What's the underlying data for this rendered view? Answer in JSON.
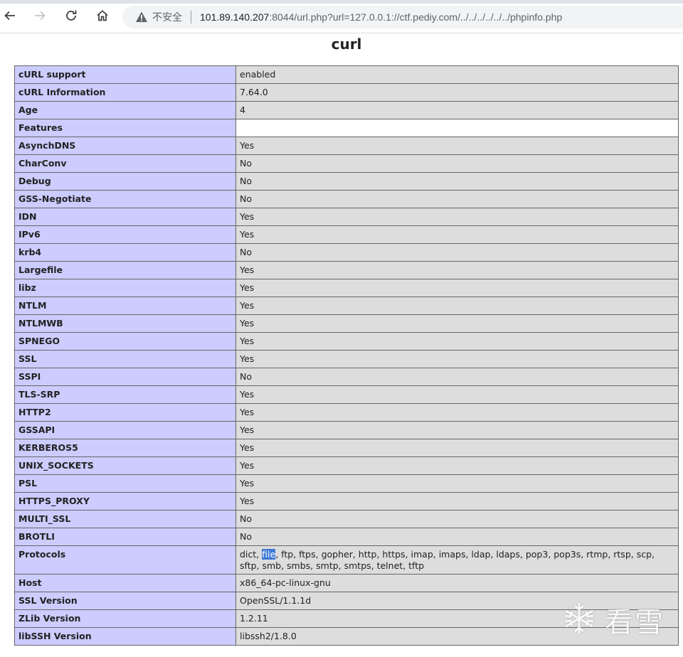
{
  "browser": {
    "back_icon": "arrow-left-icon",
    "forward_icon": "arrow-right-icon",
    "reload_icon": "reload-icon",
    "home_icon": "home-icon",
    "security_icon": "warning-triangle-icon",
    "security_label": "不安全",
    "url_host": "101.89.140.207",
    "url_rest": ":8044/url.php?url=127.0.0.1://ctf.pediy.com/../../../../../../phpinfo.php"
  },
  "page": {
    "title": "curl",
    "rows": [
      {
        "key": "cURL support",
        "value": "enabled"
      },
      {
        "key": "cURL Information",
        "value": "7.64.0"
      },
      {
        "key": "Age",
        "value": "4"
      },
      {
        "key": "Features",
        "value": ""
      },
      {
        "key": "AsynchDNS",
        "value": "Yes"
      },
      {
        "key": "CharConv",
        "value": "No"
      },
      {
        "key": "Debug",
        "value": "No"
      },
      {
        "key": "GSS-Negotiate",
        "value": "No"
      },
      {
        "key": "IDN",
        "value": "Yes"
      },
      {
        "key": "IPv6",
        "value": "Yes"
      },
      {
        "key": "krb4",
        "value": "No"
      },
      {
        "key": "Largefile",
        "value": "Yes"
      },
      {
        "key": "libz",
        "value": "Yes"
      },
      {
        "key": "NTLM",
        "value": "Yes"
      },
      {
        "key": "NTLMWB",
        "value": "Yes"
      },
      {
        "key": "SPNEGO",
        "value": "Yes"
      },
      {
        "key": "SSL",
        "value": "Yes"
      },
      {
        "key": "SSPI",
        "value": "No"
      },
      {
        "key": "TLS-SRP",
        "value": "Yes"
      },
      {
        "key": "HTTP2",
        "value": "Yes"
      },
      {
        "key": "GSSAPI",
        "value": "Yes"
      },
      {
        "key": "KERBEROS5",
        "value": "Yes"
      },
      {
        "key": "UNIX_SOCKETS",
        "value": "Yes"
      },
      {
        "key": "PSL",
        "value": "Yes"
      },
      {
        "key": "HTTPS_PROXY",
        "value": "Yes"
      },
      {
        "key": "MULTI_SSL",
        "value": "No"
      },
      {
        "key": "BROTLI",
        "value": "No"
      },
      {
        "key": "Protocols",
        "value": "dict, file, ftp, ftps, gopher, http, https, imap, imaps, ldap, ldaps, pop3, pop3s, rtmp, rtsp, scp, sftp, smb, smbs, smtp, smtps, telnet, tftp",
        "highlight": "file"
      },
      {
        "key": "Host",
        "value": "x86_64-pc-linux-gnu"
      },
      {
        "key": "SSL Version",
        "value": "OpenSSL/1.1.1d"
      },
      {
        "key": "ZLib Version",
        "value": "1.2.11"
      },
      {
        "key": "libSSH Version",
        "value": "libssh2/1.8.0"
      }
    ]
  },
  "watermark": {
    "icon": "snowflake-icon",
    "text": "看雪"
  },
  "colors": {
    "key_cell": "#ccccff",
    "value_cell": "#dddddd",
    "selection": "#3c78d8"
  }
}
